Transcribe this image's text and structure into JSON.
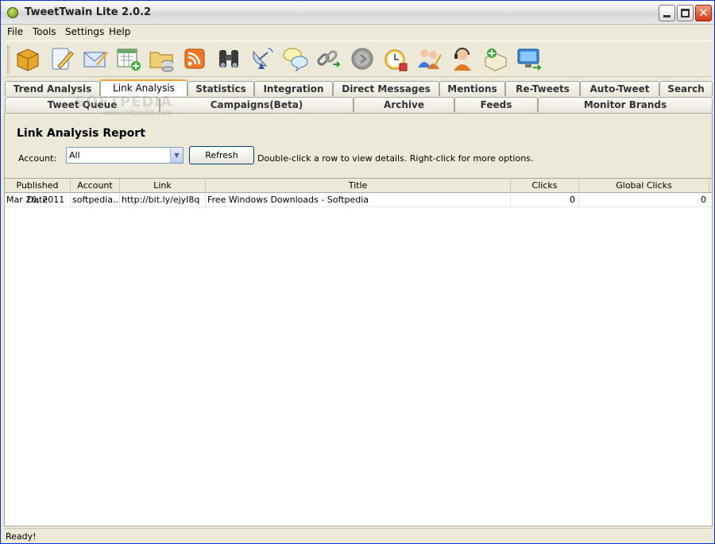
{
  "window": {
    "title": "TweetTwain Lite 2.0.2"
  },
  "titlebar_buttons": {
    "close_glyph": "✕"
  },
  "menu": [
    "File",
    "Tools",
    "Settings",
    "Help"
  ],
  "toolbar_icons": [
    "package-icon",
    "compose-icon",
    "mail-icon",
    "calendar-add-icon",
    "folder-database-icon",
    "rss-icon",
    "binoculars-icon",
    "satellite-dish-icon",
    "chat-bubbles-icon",
    "link-icon",
    "clock-disabled-icon",
    "alarm-clock-icon",
    "users-icon",
    "support-headset-icon",
    "add-box-icon",
    "monitor-icon"
  ],
  "tabs_row1": [
    "Trend Analysis",
    "Link Analysis",
    "Statistics",
    "Integration",
    "Direct Messages",
    "Mentions",
    "Re-Tweets",
    "Auto-Tweet",
    "Search"
  ],
  "tabs_row2": [
    "Tweet Queue",
    "Campaigns(Beta)",
    "Archive",
    "Feeds",
    "Monitor Brands"
  ],
  "active_tab": "Link Analysis",
  "report": {
    "title": "Link Analysis Report",
    "account_label": "Account:",
    "account_value": "All",
    "refresh_label": "Refresh",
    "hint": "Double-click a row to view details. Right-click for more options."
  },
  "table": {
    "columns": [
      "Published Date",
      "Account",
      "Link",
      "Title",
      "Clicks",
      "Global Clicks"
    ],
    "rows": [
      {
        "date": "Mar 26, 2011",
        "account": "softpedia...",
        "link": "http://bit.ly/ejyI8q",
        "title": "Free Windows Downloads - Softpedia",
        "clicks": "0",
        "global_clicks": "0"
      }
    ]
  },
  "status": "Ready!",
  "watermark": {
    "text": "SOFTPEDIA",
    "url": "www.softpedia.com"
  }
}
